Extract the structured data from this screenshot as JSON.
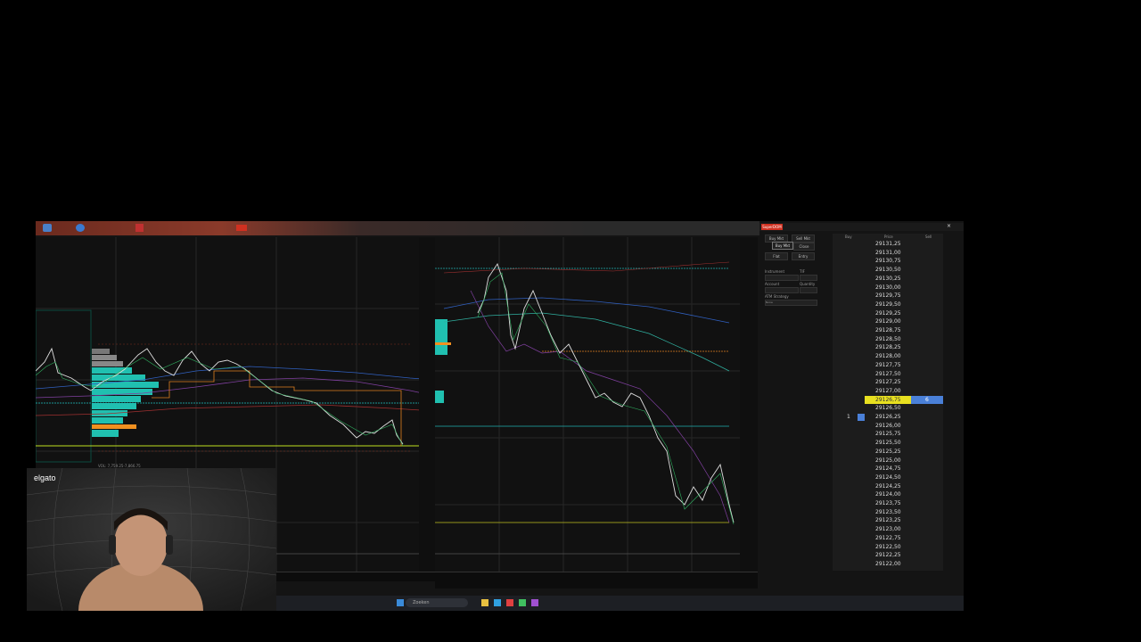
{
  "superdom": {
    "title": "SuperDOM",
    "buy_mkt": "Buy Mkt",
    "sell_mkt": "Sell Mkt",
    "tooltip": "Buy Mkt",
    "close": "Close",
    "flat": "Flat",
    "entry": "Entry",
    "instrument_label": "Instrument",
    "tif_label": "TIF",
    "account_label": "Account",
    "quantity_label": "Quantity",
    "atm_label": "ATM Strategy",
    "atm_value": "None",
    "col_buy": "Buy",
    "col_price": "Price",
    "col_sell": "Sell",
    "prices": [
      "29131,25",
      "29131,00",
      "29130,75",
      "29130,50",
      "29130,25",
      "29130,00",
      "29129,75",
      "29129,50",
      "29129,25",
      "29129,00",
      "29128,75",
      "29128,50",
      "29128,25",
      "29128,00",
      "29127,75",
      "29127,50",
      "29127,25",
      "29127,00",
      "29126,75",
      "29126,50",
      "29126,25",
      "29126,00",
      "29125,75",
      "29125,50",
      "29125,25",
      "29125,00",
      "29124,75",
      "29124,50",
      "29124,25",
      "29124,00",
      "29123,75",
      "29123,50",
      "29123,25",
      "29123,00",
      "29122,75",
      "29122,50",
      "29122,25",
      "29122,00"
    ],
    "highlight_price": "29126,75",
    "highlight_sell_qty": "6",
    "position_qty": "1"
  },
  "webcam": {
    "label": "elgato"
  },
  "taskbar": {
    "search": "Zoeken"
  }
}
